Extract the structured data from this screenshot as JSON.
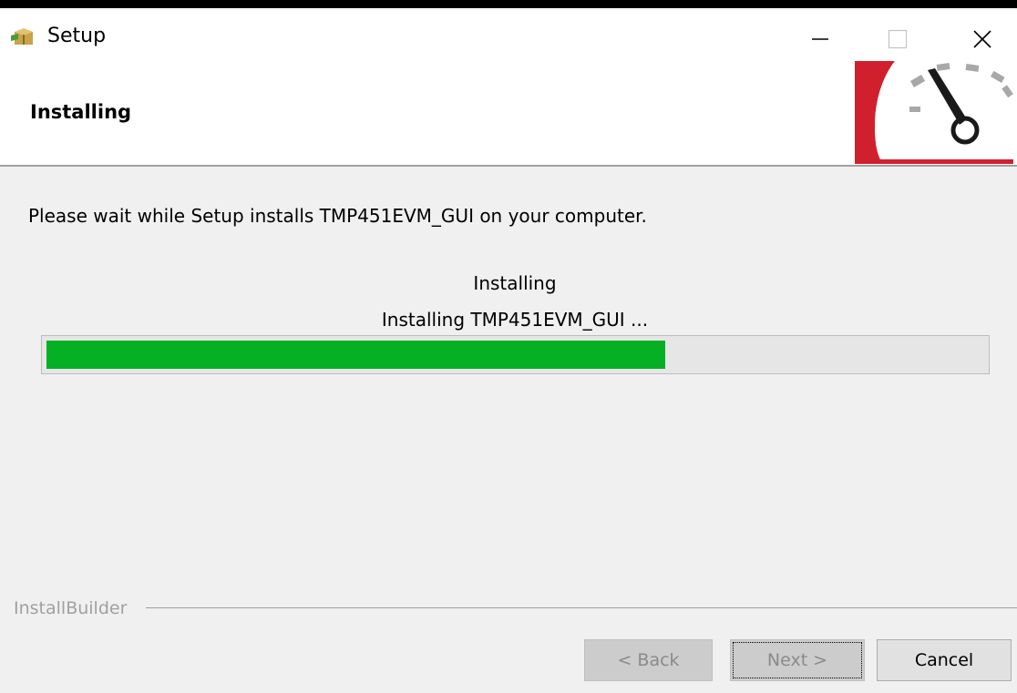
{
  "window": {
    "title": "Setup",
    "icon": "installer-box-icon",
    "controls": [
      "minimize-icon",
      "maximize-icon",
      "close-icon"
    ]
  },
  "header": {
    "title": "Installing",
    "logo": "gauge-logo-icon"
  },
  "main": {
    "intro": "Please wait while Setup installs TMP451EVM_GUI on your computer.",
    "status_title": "Installing",
    "status_detail": "Installing TMP451EVM_GUI ...",
    "progress": 0.66
  },
  "footer": {
    "brand": "InstallBuilder",
    "back_label": "< Back",
    "next_label": "Next >",
    "cancel_label": "Cancel"
  },
  "colors": {
    "progress_fill": "#06b025",
    "logo_red": "#d0202e",
    "window_bg": "#f0f0f0"
  }
}
